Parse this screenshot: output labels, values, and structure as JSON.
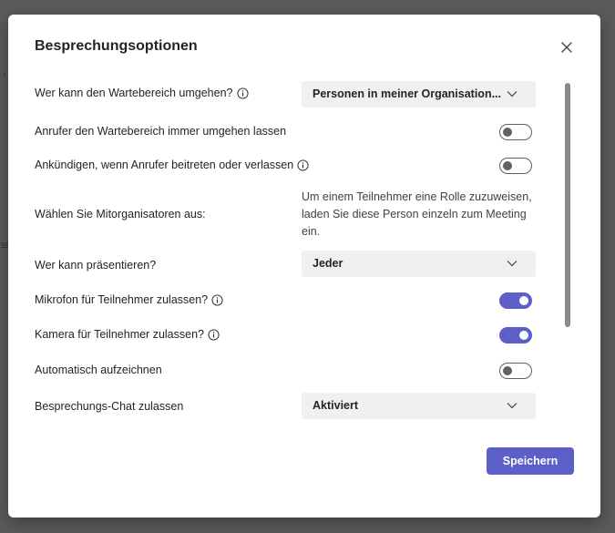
{
  "dialog": {
    "title": "Besprechungsoptionen",
    "close_icon": "close-icon",
    "save_label": "Speichern"
  },
  "options": {
    "lobby_bypass": {
      "label": "Wer kann den Wartebereich umgehen?",
      "value": "Personen in meiner Organisation..."
    },
    "callers_bypass": {
      "label": "Anrufer den Wartebereich immer umgehen lassen",
      "enabled": false
    },
    "announce_callers": {
      "label": "Ankündigen, wenn Anrufer beitreten oder verlassen",
      "enabled": false
    },
    "co_organizers": {
      "label": "Wählen Sie Mitorganisatoren aus:",
      "note": "Um einem Teilnehmer eine Rolle zuzuweisen, laden Sie diese Person einzeln zum Meeting ein."
    },
    "presenters": {
      "label": "Wer kann präsentieren?",
      "value": "Jeder"
    },
    "allow_mic": {
      "label": "Mikrofon für Teilnehmer zulassen?",
      "enabled": true
    },
    "allow_camera": {
      "label": "Kamera für Teilnehmer zulassen?",
      "enabled": true
    },
    "auto_record": {
      "label": "Automatisch aufzeichnen",
      "enabled": false
    },
    "meeting_chat": {
      "label": "Besprechungs-Chat zulassen",
      "value": "Aktiviert"
    }
  },
  "colors": {
    "accent": "#5b5fc7",
    "backdrop": "#5b5b5b",
    "dropdown_bg": "#f0f0f0"
  }
}
